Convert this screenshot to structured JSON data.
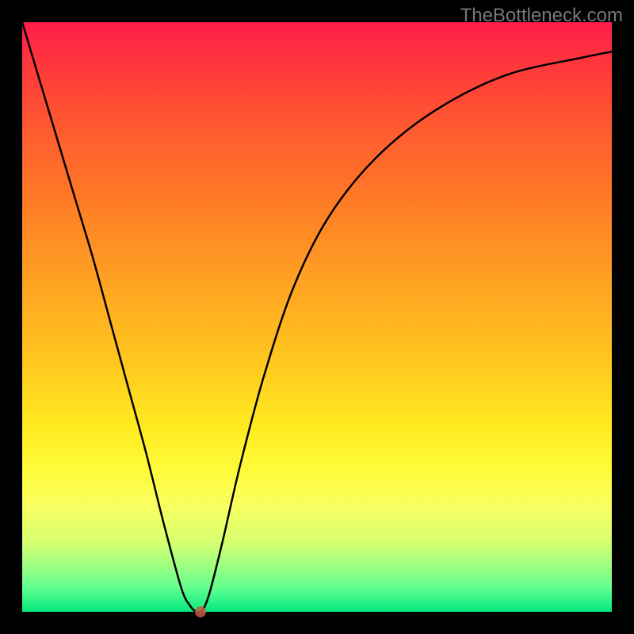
{
  "watermark": "TheBottleneck.com",
  "chart_data": {
    "type": "line",
    "title": "",
    "xlabel": "",
    "ylabel": "",
    "xlim": [
      0,
      100
    ],
    "ylim": [
      0,
      100
    ],
    "curve": {
      "x": [
        0,
        3,
        6,
        9,
        12,
        15,
        18,
        21,
        24,
        27,
        28.5,
        29.5,
        30.2,
        31,
        32,
        34,
        37,
        41,
        46,
        52,
        60,
        70,
        82,
        95,
        100
      ],
      "y": [
        100,
        90,
        80,
        70,
        60,
        49,
        38,
        27,
        15,
        4,
        1,
        0,
        0,
        1,
        4,
        12,
        25,
        40,
        55,
        67,
        77,
        85,
        91,
        94,
        95
      ]
    },
    "marker": {
      "x": 30.2,
      "y": 0
    },
    "colors": {
      "curve": "#000000",
      "marker": "#c85a46",
      "background_gradient": [
        "#ff1e4a",
        "#ffa522",
        "#fffb3a",
        "#03e97e"
      ]
    }
  }
}
